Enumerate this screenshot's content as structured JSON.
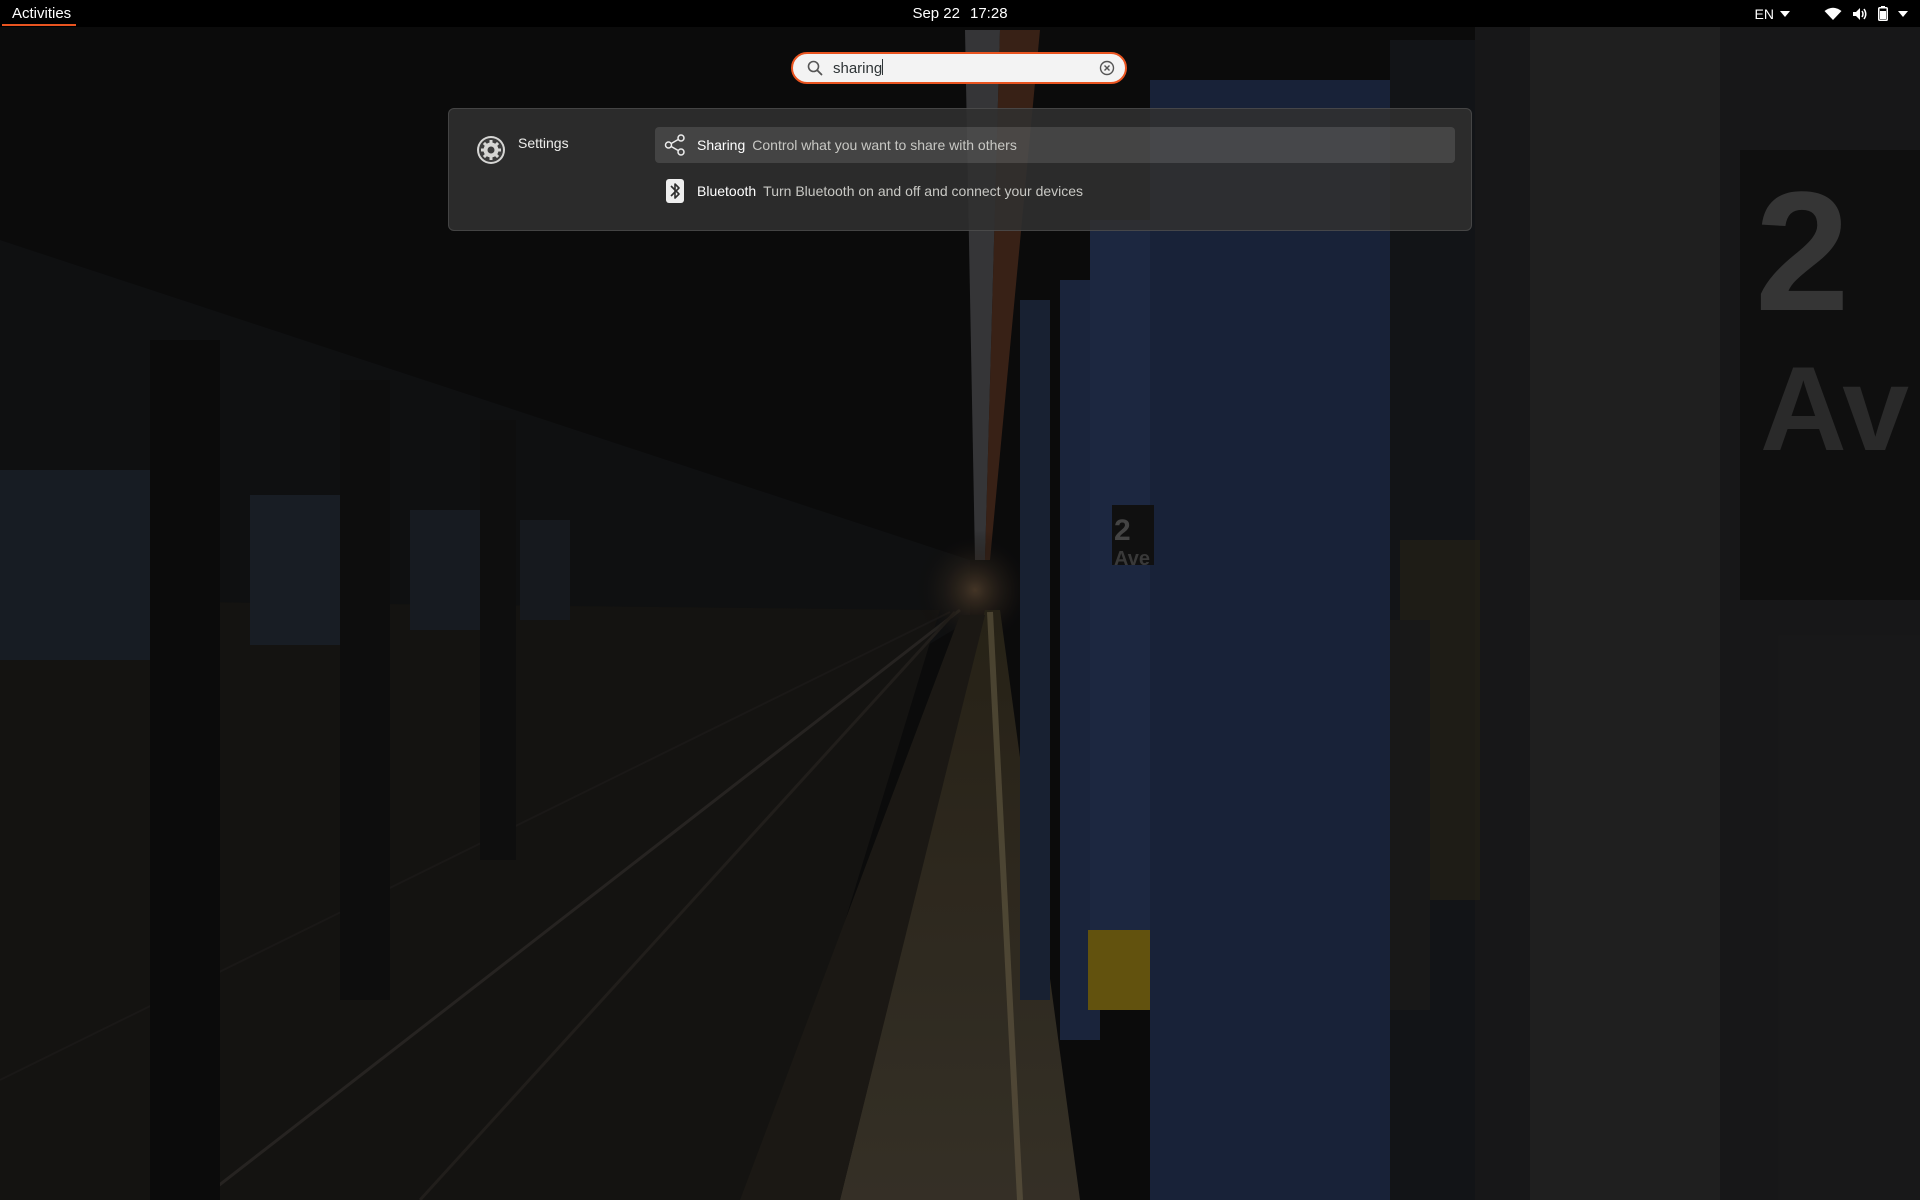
{
  "topbar": {
    "activities_label": "Activities",
    "date": "Sep 22",
    "time": "17:28",
    "language": "EN",
    "icons": [
      "wifi-icon",
      "volume-icon",
      "battery-icon",
      "system-menu-chevron-icon"
    ]
  },
  "search": {
    "value": "sharing",
    "icon": "search-icon",
    "clear_icon": "clear-icon"
  },
  "results": {
    "provider": {
      "name": "Settings",
      "icon": "settings-gear-icon"
    },
    "items": [
      {
        "title": "Sharing",
        "description": "Control what you want to share with others",
        "icon": "share-icon",
        "selected": true
      },
      {
        "title": "Bluetooth",
        "description": "Turn Bluetooth on and off and connect your devices",
        "icon": "bluetooth-icon",
        "selected": false
      }
    ]
  },
  "colors": {
    "accent": "#e95420",
    "topbar": "#000000",
    "panel": "#303030"
  },
  "wallpaper": {
    "sign_number": "2",
    "sign_text": "Av",
    "pillar_sign_text": "Ave"
  }
}
